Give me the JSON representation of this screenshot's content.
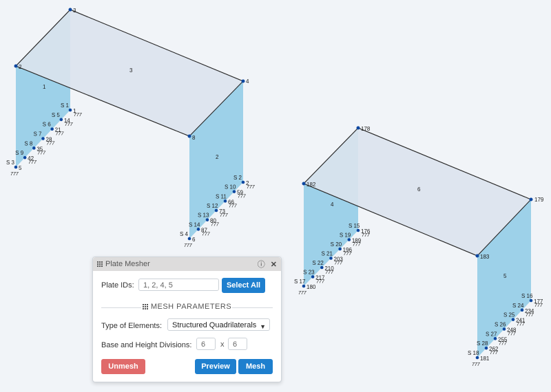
{
  "model": {
    "nodes": {
      "n2": "2",
      "n3": "3",
      "n4": "4",
      "n8": "8",
      "n178": "178",
      "n182": "182",
      "n179": "179",
      "n183": "183"
    },
    "plates": {
      "p1": "1",
      "p2": "2",
      "p3": "3",
      "p4": "4",
      "p5": "5",
      "p6": "6"
    },
    "supports_a": {
      "top_nodes": [
        "1",
        "14",
        "21",
        "28",
        "35",
        "42",
        "5"
      ],
      "support_labels": [
        "S 1",
        "S 5",
        "S 6",
        "S 7",
        "S 8",
        "S 9",
        "S 3"
      ],
      "fixity": "777"
    },
    "supports_b": {
      "top_nodes": [
        "2",
        "59",
        "66",
        "73",
        "80",
        "87",
        "6"
      ],
      "support_labels": [
        "S 2",
        "S 10",
        "S 11",
        "S 12",
        "S 13",
        "S 14",
        "S 4"
      ],
      "fixity": "777"
    },
    "supports_c": {
      "top_nodes": [
        "176",
        "189",
        "196",
        "203",
        "210",
        "217",
        "180"
      ],
      "support_labels": [
        "S 15",
        "S 19",
        "S 20",
        "S 21",
        "S 22",
        "S 23",
        "S 17"
      ],
      "fixity": "777"
    },
    "supports_d": {
      "top_nodes": [
        "177",
        "234",
        "241",
        "248",
        "255",
        "262",
        "181"
      ],
      "support_labels": [
        "S 16",
        "S 24",
        "S 25",
        "S 26",
        "S 27",
        "S 28",
        "S 18"
      ],
      "fixity": "777"
    },
    "colors": {
      "wall": "#8ecae6",
      "roof": "#dbe3ed",
      "node": "#0d47a1",
      "edge": "#2b2b2b"
    }
  },
  "panel": {
    "title": "Plate Mesher",
    "plate_ids_label": "Plate IDs:",
    "plate_ids_value": "1, 2, 4, 5",
    "select_all": "Select All",
    "section_title": "MESH PARAMETERS",
    "type_label": "Type of Elements:",
    "type_value": "Structured Quadrilaterals",
    "divisions_label": "Base and Height Divisions:",
    "div_base": "6",
    "div_times": "x",
    "div_height": "6",
    "unmesh": "Unmesh",
    "preview": "Preview",
    "mesh": "Mesh"
  }
}
